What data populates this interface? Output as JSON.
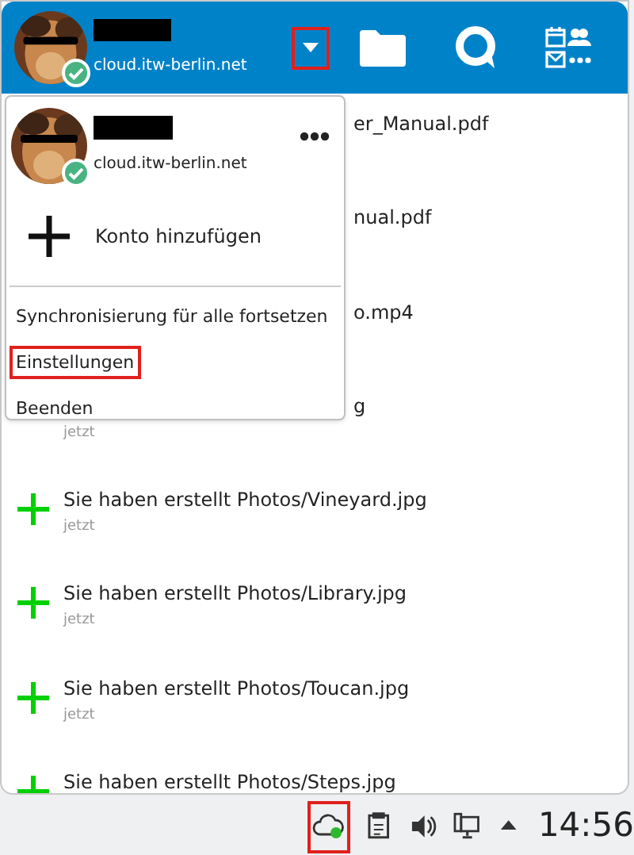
{
  "header": {
    "account_host": "cloud.itw-berlin.net",
    "online": true,
    "dropdown_highlighted": true
  },
  "activities": [
    {
      "kind": "partial",
      "text": "er_Manual.pdf"
    },
    {
      "kind": "partial",
      "text": "nual.pdf"
    },
    {
      "kind": "partial",
      "text": "o.mp4"
    },
    {
      "kind": "partial",
      "text": "g",
      "time": "jetzt"
    },
    {
      "kind": "full",
      "text": "Sie haben erstellt Photos/Vineyard.jpg",
      "time": "jetzt"
    },
    {
      "kind": "full",
      "text": "Sie haben erstellt Photos/Library.jpg",
      "time": "jetzt"
    },
    {
      "kind": "full",
      "text": "Sie haben erstellt Photos/Toucan.jpg",
      "time": "jetzt"
    },
    {
      "kind": "full",
      "text": "Sie haben erstellt Photos/Steps.jpg"
    }
  ],
  "menu": {
    "account_host": "cloud.itw-berlin.net",
    "online": true,
    "add_account": "Konto hinzufügen",
    "items": [
      {
        "label": "Synchronisierung für alle fortsetzen",
        "highlighted": false
      },
      {
        "label": "Einstellungen",
        "highlighted": true
      },
      {
        "label": "Beenden",
        "highlighted": false
      }
    ]
  },
  "taskbar": {
    "cloud_highlighted": true,
    "clock": "14:56"
  }
}
